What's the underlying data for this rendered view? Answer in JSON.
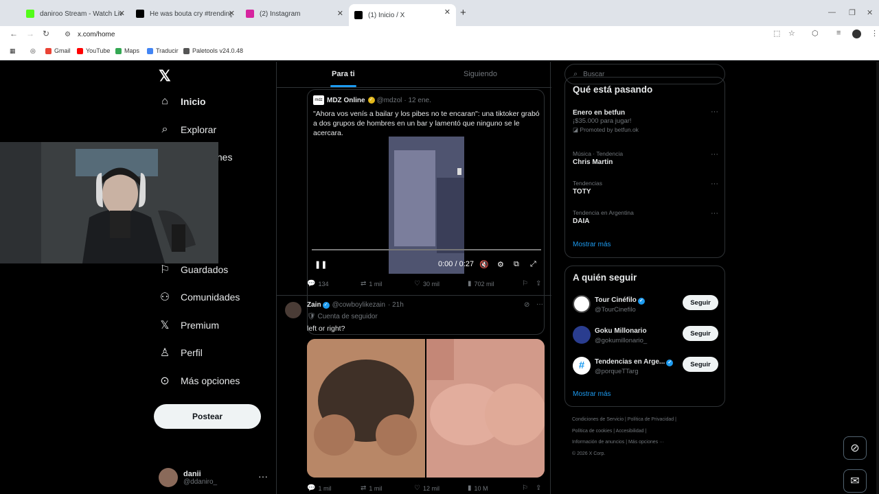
{
  "browser": {
    "tabs": [
      {
        "title": "daniroo Stream - Watch Live on",
        "color": "#53fc18"
      },
      {
        "title": "He was bouta cry #trending #F",
        "color": "#000000"
      },
      {
        "title": "(2) Instagram",
        "color": "#d6249f"
      },
      {
        "title": "(1) Inicio / X",
        "color": "#000000"
      }
    ],
    "url": "x.com/home",
    "bookmarks": [
      {
        "label": "Gmail",
        "color": "#ea4335"
      },
      {
        "label": "YouTube",
        "color": "#ff0000"
      },
      {
        "label": "Maps",
        "color": "#34a853"
      },
      {
        "label": "Traducir",
        "color": "#4285f4"
      },
      {
        "label": "Paletools v24.0.48",
        "color": "#555555"
      }
    ]
  },
  "nav": {
    "items": [
      {
        "label": "Inicio",
        "icon": "home-icon"
      },
      {
        "label": "Explorar",
        "icon": "search-icon"
      },
      {
        "label": "iones",
        "icon": "bell-icon"
      },
      {
        "label": "Guardados",
        "icon": "bookmark-icon"
      },
      {
        "label": "Comunidades",
        "icon": "communities-icon"
      },
      {
        "label": "Premium",
        "icon": "x-icon"
      },
      {
        "label": "Perfil",
        "icon": "person-icon"
      },
      {
        "label": "Más opciones",
        "icon": "more-icon"
      }
    ],
    "post_label": "Postear",
    "account": {
      "name": "danii",
      "handle": "@ddaniro_"
    }
  },
  "feed": {
    "tabs": [
      "Para ti",
      "Siguiendo"
    ],
    "quote": {
      "name": "MDZ Online",
      "handle": "@mdzol",
      "date": "· 12 ene.",
      "text": "\"Ahora vos venís a bailar y los pibes no te encaran\": una tiktoker grabó a dos grupos de hombres en un bar y lamentó que ninguno se le acercara.",
      "video_time": "0:00 / 0:27"
    },
    "tweet1_actions": {
      "replies": "134",
      "reposts": "1 mil",
      "likes": "30 mil",
      "views": "702 mil"
    },
    "tweet2": {
      "name": "Zain",
      "handle": "@cowboylikezain",
      "time": "· 21h",
      "subtitle": "Cuenta de seguidor",
      "text": "left or right?"
    },
    "tweet2_actions": {
      "replies": "1 mil",
      "reposts": "1 mil",
      "likes": "12 mil",
      "views": "10 M"
    }
  },
  "sidebar": {
    "search_placeholder": "Buscar",
    "trends_title": "Qué está pasando",
    "trends": [
      {
        "context": "",
        "name": "Enero en betfun",
        "note": "¡$35.000 para jugar!",
        "promo": "Promoted by betfun.ok"
      },
      {
        "context": "Música · Tendencia",
        "name": "Chris Martin",
        "note": "",
        "promo": ""
      },
      {
        "context": "Tendencias",
        "name": "TOTY",
        "note": "",
        "promo": ""
      },
      {
        "context": "Tendencia en Argentina",
        "name": "DAIA",
        "note": "",
        "promo": ""
      }
    ],
    "show_more": "Mostrar más",
    "follow_title": "A quién seguir",
    "follow": [
      {
        "name": "Tour Cinéfilo",
        "handle": "@TourCinefilo",
        "button": "Seguir",
        "color": "#ffffff"
      },
      {
        "name": "Goku Millonario",
        "handle": "@gokumillonario_",
        "button": "Seguir",
        "color": "#2a3d8f"
      },
      {
        "name": "Tendencias en Arge...",
        "handle": "@porqueTTarg",
        "button": "Seguir",
        "color": "#ffffff"
      }
    ],
    "footer": [
      "Condiciones de Servicio | Política de Privacidad |",
      "Política de cookies | Accesibilidad |",
      "Información de anuncios | Más opciones ···",
      "© 2026 X Corp."
    ]
  }
}
